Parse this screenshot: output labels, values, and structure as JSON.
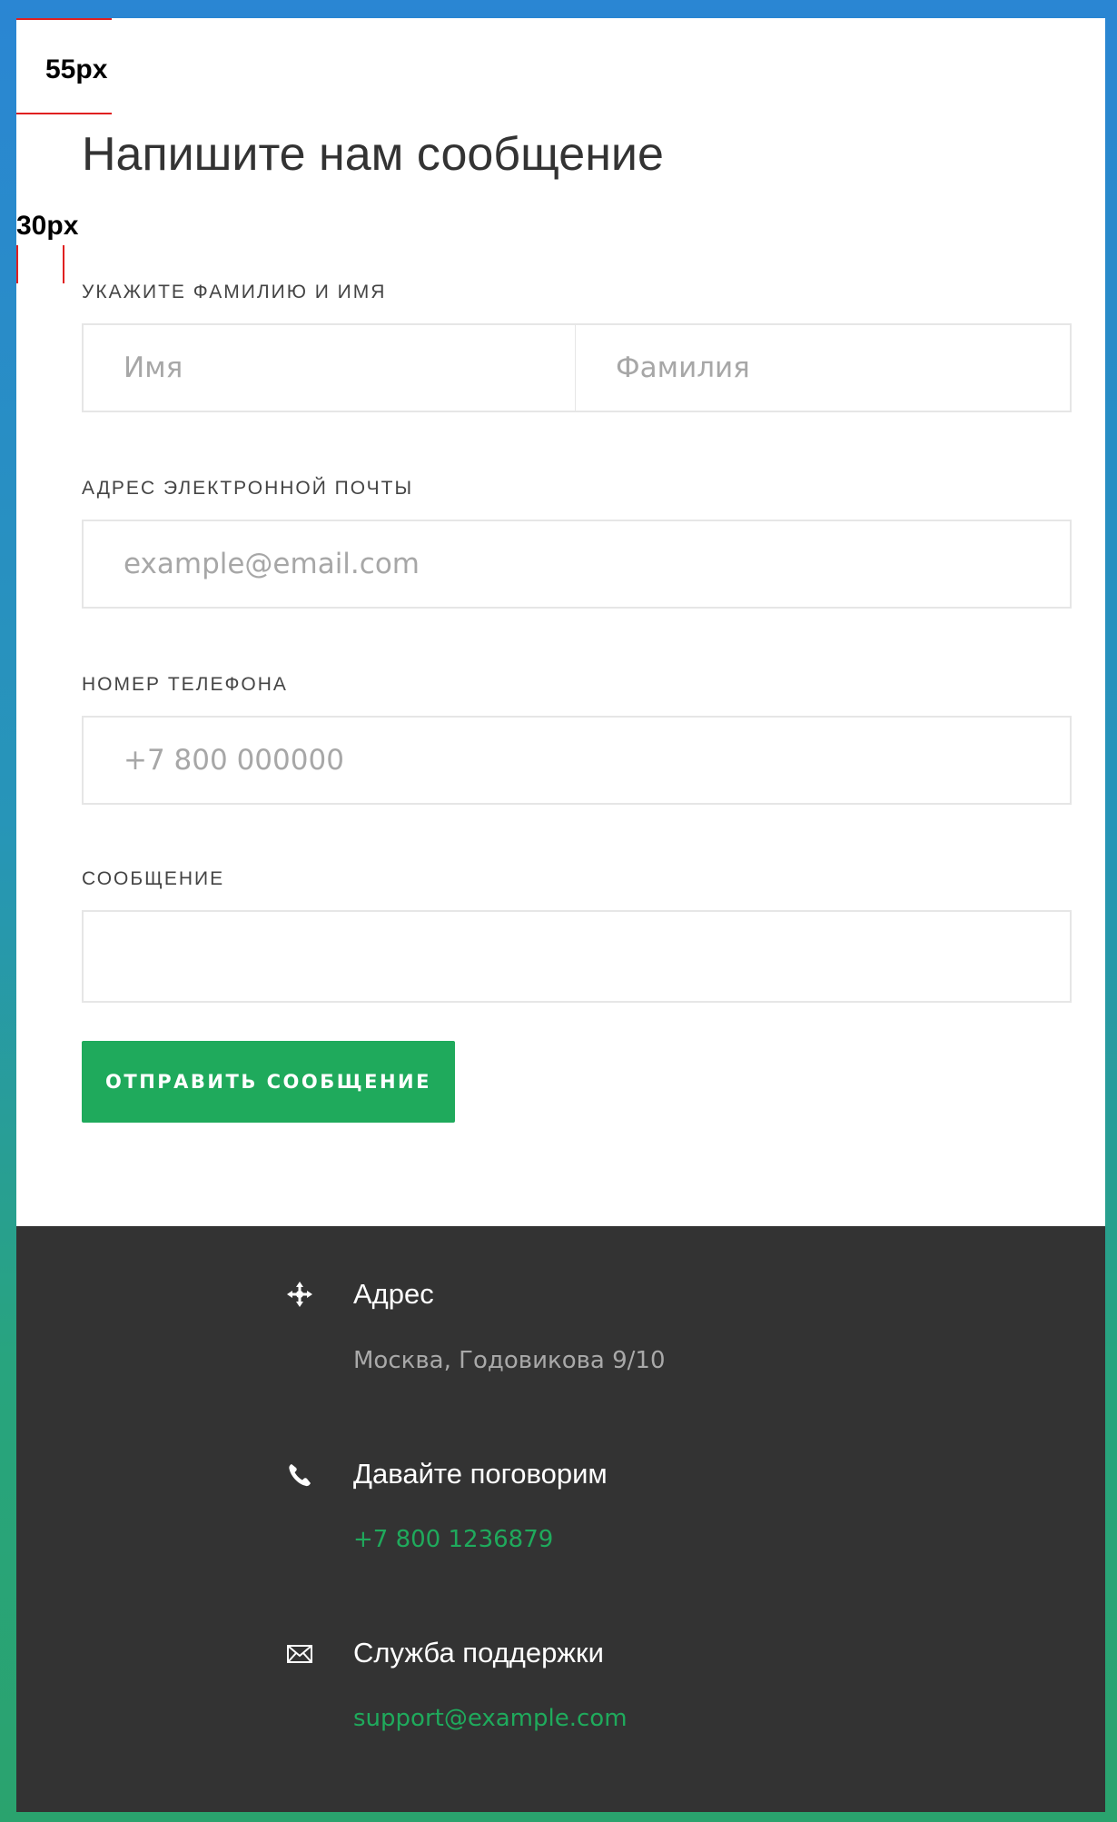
{
  "annotations": {
    "top_spacing": "55px",
    "left_spacing": "30px"
  },
  "form": {
    "title": "Напишите нам сообщение",
    "name_label": "Укажите фамилию и имя",
    "first_name_placeholder": "Имя",
    "last_name_placeholder": "Фамилия",
    "email_label": "Адрес электронной почты",
    "email_placeholder": "example@email.com",
    "phone_label": "Номер телефона",
    "phone_placeholder": "+7 800 000000",
    "message_label": "Сообщение",
    "message_placeholder": "",
    "submit_label": "ОТПРАВИТЬ СООБЩЕНИЕ"
  },
  "footer": {
    "items": [
      {
        "icon": "move-arrows-icon",
        "title": "Адрес",
        "value": "Москва, Годовикова 9/10"
      },
      {
        "icon": "phone-icon",
        "title": "Давайте поговорим",
        "value": "+7 800 1236879"
      },
      {
        "icon": "envelope-icon",
        "title": "Служба поддержки",
        "value": "support@example.com"
      }
    ]
  },
  "colors": {
    "accent": "#1faa5c",
    "footer_bg": "#333333",
    "frame_top": "#2a86d3",
    "frame_bottom": "#2aa36e"
  }
}
